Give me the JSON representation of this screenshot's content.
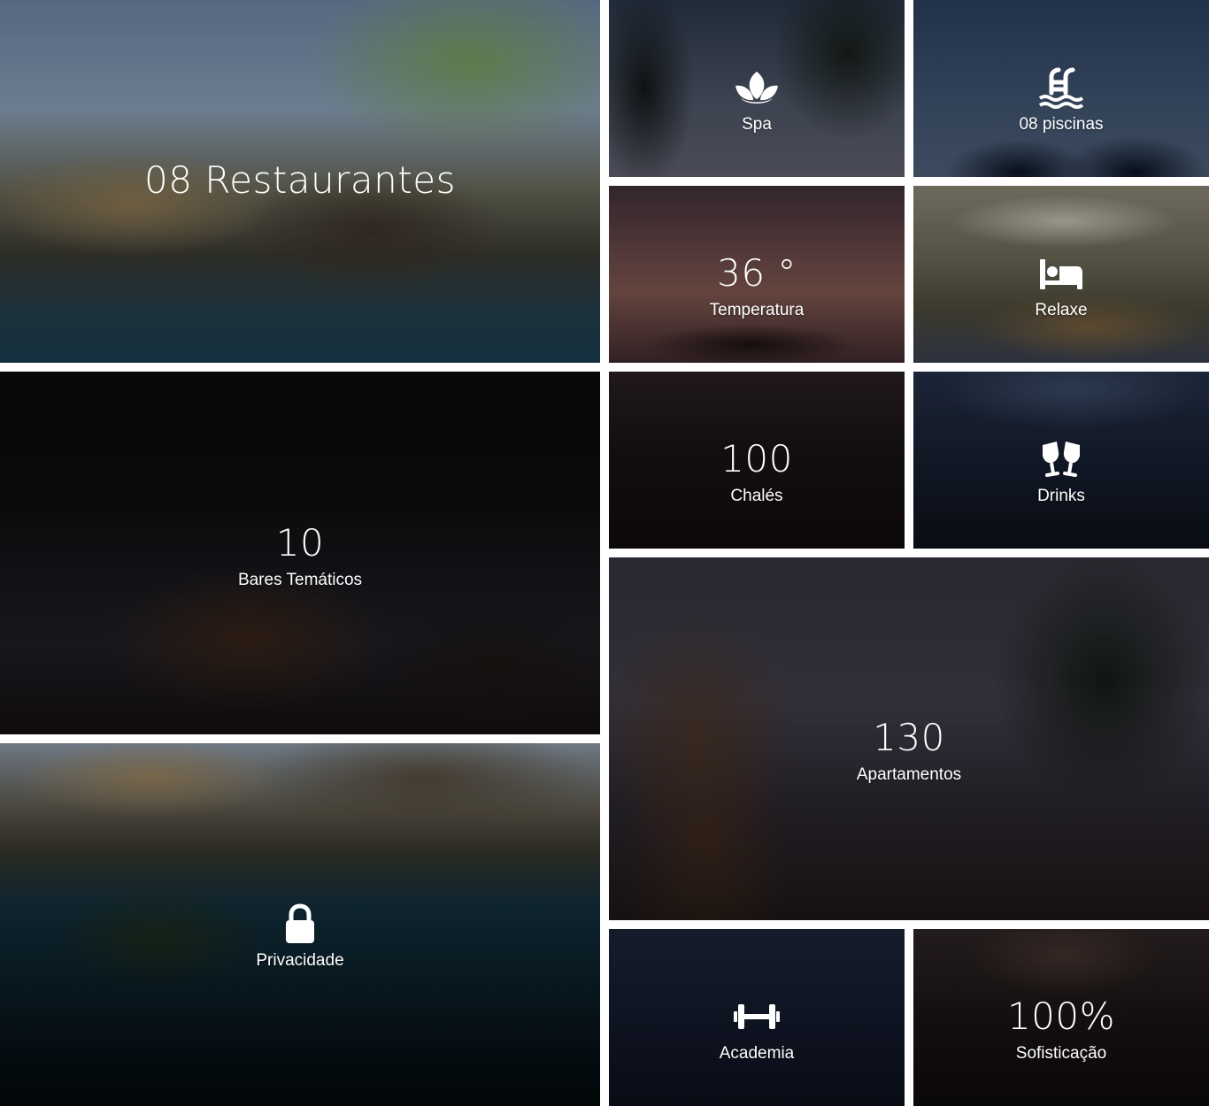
{
  "tiles": {
    "restaurantes": {
      "value": "08 Restaurantes"
    },
    "spa": {
      "label": "Spa",
      "icon": "lotus-icon"
    },
    "piscinas": {
      "label": "08 piscinas",
      "icon": "pool-icon"
    },
    "temperatura": {
      "value": "36 °",
      "label": "Temperatura"
    },
    "relaxe": {
      "label": "Relaxe",
      "icon": "bed-icon"
    },
    "bares": {
      "value": "10",
      "label": "Bares Temáticos"
    },
    "chales": {
      "value": "100",
      "label": "Chalés"
    },
    "drinks": {
      "label": "Drinks",
      "icon": "glasses-cheers-icon"
    },
    "apartamentos": {
      "value": "130",
      "label": "Apartamentos"
    },
    "privacidade": {
      "label": "Privacidade",
      "icon": "lock-icon"
    },
    "academia": {
      "label": "Academia",
      "icon": "dumbbell-icon"
    },
    "sofisticacao": {
      "value": "100%",
      "label": "Sofisticação"
    }
  },
  "colors": {
    "text": "#ffffff",
    "gap": "#ffffff"
  }
}
